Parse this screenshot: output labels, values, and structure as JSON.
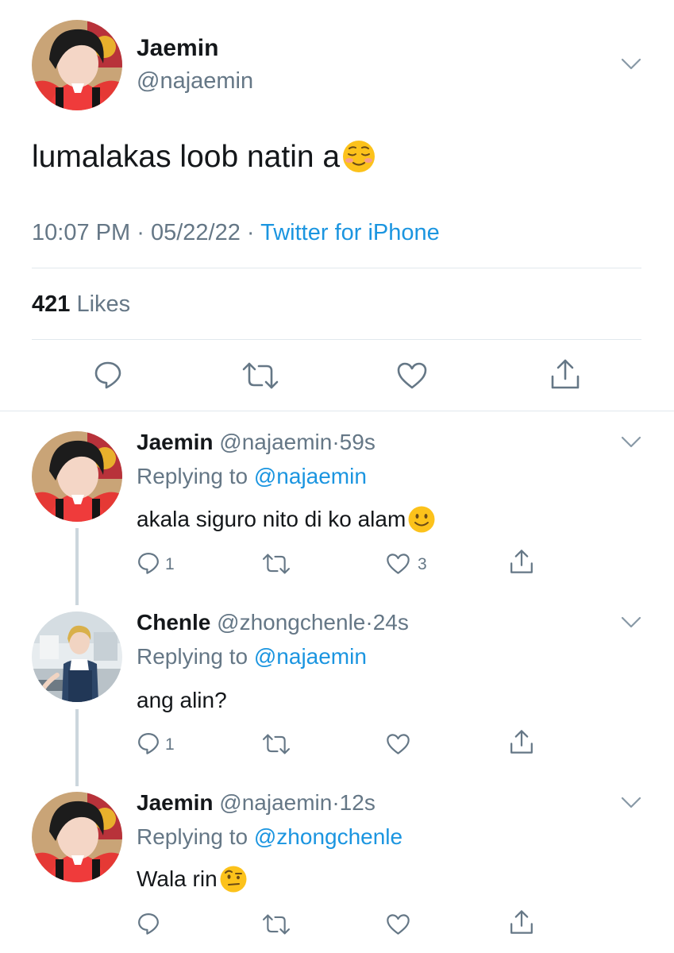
{
  "main_tweet": {
    "author_name": "Jaemin",
    "author_handle": "@najaemin",
    "text": "lumalakas loob natin a",
    "emoji": "relieved-face",
    "time": "10:07 PM",
    "separator": "·",
    "date": "05/22/22",
    "source": "Twitter for iPhone",
    "likes_count": "421",
    "likes_label": "Likes"
  },
  "replies": [
    {
      "author_name": "Jaemin",
      "author_handle": "@najaemin",
      "dot": "·",
      "age": "59s",
      "replying_prefix": "Replying to ",
      "replying_to": "@najaemin",
      "text": "akala siguro nito di ko alam",
      "emoji": "slightly-smiling-face",
      "reply_count": "1",
      "like_count": "3"
    },
    {
      "author_name": "Chenle",
      "author_handle": "@zhongchenle",
      "dot": "·",
      "age": "24s",
      "replying_prefix": "Replying to ",
      "replying_to": "@najaemin",
      "text": "ang alin?",
      "emoji": "",
      "reply_count": "1",
      "like_count": ""
    },
    {
      "author_name": "Jaemin",
      "author_handle": "@najaemin",
      "dot": "·",
      "age": "12s",
      "replying_prefix": "Replying to ",
      "replying_to": "@zhongchenle",
      "text": "Wala rin",
      "emoji": "face-with-raised-eyebrow",
      "reply_count": "",
      "like_count": ""
    }
  ],
  "colors": {
    "text": "#14171a",
    "secondary": "#657786",
    "link": "#1b95e0",
    "divider": "#e1e8ed"
  }
}
